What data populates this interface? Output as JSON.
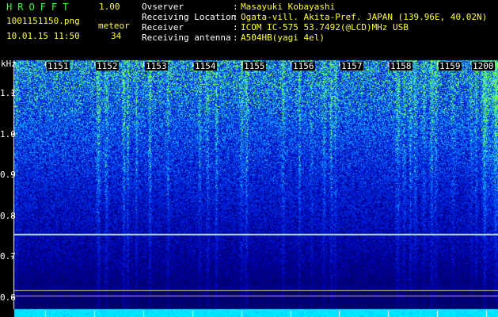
{
  "app": {
    "title": "HROFFT",
    "version": "1.00"
  },
  "file": {
    "name": "1001151150.png",
    "datetime": "10.01.15 11:50"
  },
  "meteor": {
    "label": "meteor",
    "count": "34"
  },
  "info": [
    {
      "label": "Ovserver",
      "value": "Masayuki Kobayashi"
    },
    {
      "label": "Receiving Location",
      "value": "Ogata-vill. Akita-Pref. JAPAN (139.96E, 40.02N)"
    },
    {
      "label": "Receiver",
      "value": "ICOM IC-575 53.7492(@LCD)MHz USB"
    },
    {
      "label": "Receiving antenna",
      "value": "A504HB(yagi 4el)"
    }
  ],
  "spectrogram": {
    "y_unit": "kHz",
    "y_ticks": [
      "1.1",
      "1.0",
      "0.9",
      "0.8",
      "0.7",
      "0.6"
    ],
    "x_ticks": [
      "1151",
      "1152",
      "1153",
      "1154",
      "1155",
      "1156",
      "1157",
      "1158",
      "1159",
      "1200"
    ],
    "y_range": [
      0.57,
      1.18
    ],
    "constant_carrier_khz": 0.755,
    "colors": {
      "background": "#000000",
      "deep": "#000a55",
      "mid": "#0a2ad8",
      "bright": "#3de0ff",
      "meteor": "#9bff6a",
      "carrier": "#bfe8ff"
    }
  }
}
